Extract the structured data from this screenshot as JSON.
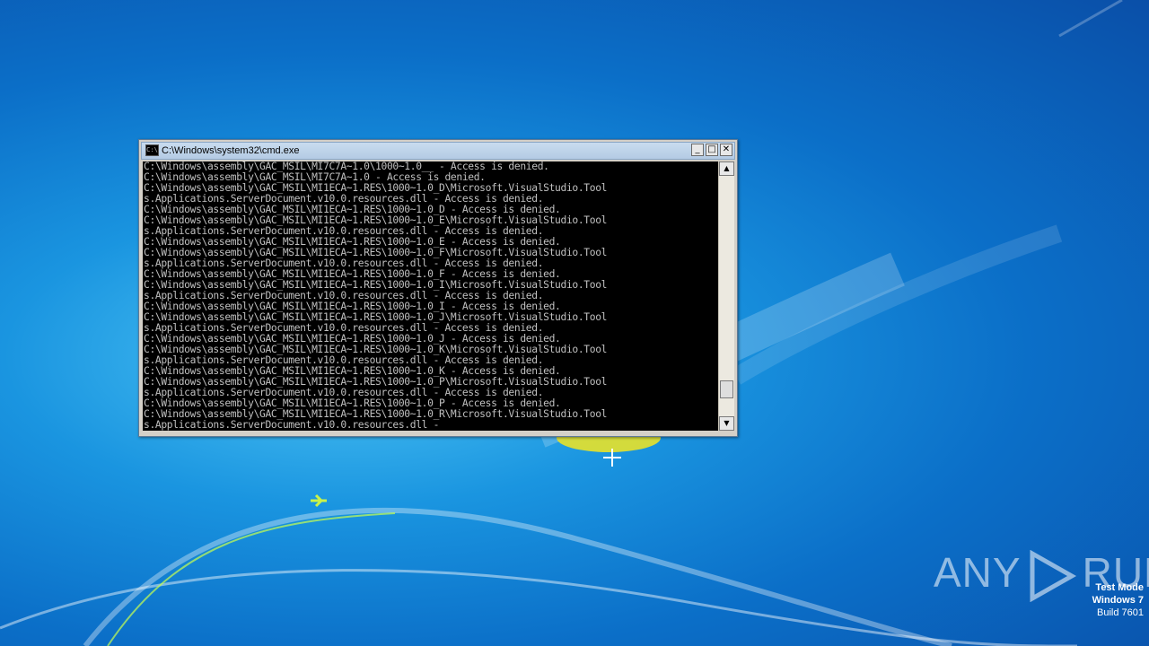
{
  "window": {
    "title": "C:\\Windows\\system32\\cmd.exe",
    "icon_label": "C:\\",
    "minimize_label": "_",
    "maximize_label": "□",
    "close_label": "✕"
  },
  "console": {
    "lines": [
      "C:\\Windows\\assembly\\GAC_MSIL\\MI7C7A~1.0\\1000~1.0__ - Access is denied.",
      "C:\\Windows\\assembly\\GAC_MSIL\\MI7C7A~1.0 - Access is denied.",
      "C:\\Windows\\assembly\\GAC_MSIL\\MI1ECA~1.RES\\1000~1.0_D\\Microsoft.VisualStudio.Tool",
      "s.Applications.ServerDocument.v10.0.resources.dll - Access is denied.",
      "C:\\Windows\\assembly\\GAC_MSIL\\MI1ECA~1.RES\\1000~1.0_D - Access is denied.",
      "C:\\Windows\\assembly\\GAC_MSIL\\MI1ECA~1.RES\\1000~1.0_E\\Microsoft.VisualStudio.Tool",
      "s.Applications.ServerDocument.v10.0.resources.dll - Access is denied.",
      "C:\\Windows\\assembly\\GAC_MSIL\\MI1ECA~1.RES\\1000~1.0_E - Access is denied.",
      "C:\\Windows\\assembly\\GAC_MSIL\\MI1ECA~1.RES\\1000~1.0_F\\Microsoft.VisualStudio.Tool",
      "s.Applications.ServerDocument.v10.0.resources.dll - Access is denied.",
      "C:\\Windows\\assembly\\GAC_MSIL\\MI1ECA~1.RES\\1000~1.0_F - Access is denied.",
      "C:\\Windows\\assembly\\GAC_MSIL\\MI1ECA~1.RES\\1000~1.0_I\\Microsoft.VisualStudio.Tool",
      "s.Applications.ServerDocument.v10.0.resources.dll - Access is denied.",
      "C:\\Windows\\assembly\\GAC_MSIL\\MI1ECA~1.RES\\1000~1.0_I - Access is denied.",
      "C:\\Windows\\assembly\\GAC_MSIL\\MI1ECA~1.RES\\1000~1.0_J\\Microsoft.VisualStudio.Tool",
      "s.Applications.ServerDocument.v10.0.resources.dll - Access is denied.",
      "C:\\Windows\\assembly\\GAC_MSIL\\MI1ECA~1.RES\\1000~1.0_J - Access is denied.",
      "C:\\Windows\\assembly\\GAC_MSIL\\MI1ECA~1.RES\\1000~1.0_K\\Microsoft.VisualStudio.Tool",
      "s.Applications.ServerDocument.v10.0.resources.dll - Access is denied.",
      "C:\\Windows\\assembly\\GAC_MSIL\\MI1ECA~1.RES\\1000~1.0_K - Access is denied.",
      "C:\\Windows\\assembly\\GAC_MSIL\\MI1ECA~1.RES\\1000~1.0_P\\Microsoft.VisualStudio.Tool",
      "s.Applications.ServerDocument.v10.0.resources.dll - Access is denied.",
      "C:\\Windows\\assembly\\GAC_MSIL\\MI1ECA~1.RES\\1000~1.0_P - Access is denied.",
      "C:\\Windows\\assembly\\GAC_MSIL\\MI1ECA~1.RES\\1000~1.0_R\\Microsoft.VisualStudio.Tool",
      "s.Applications.ServerDocument.v10.0.resources.dll -"
    ],
    "text_color": "#c0c0c0",
    "background_color": "#000000"
  },
  "scrollbar": {
    "up_label": "▲",
    "down_label": "▼",
    "scroll_position": 0.92
  },
  "watermark": {
    "text_left": "ANY",
    "text_right": "RUN"
  },
  "system_overlay": {
    "line1": "Test Mode",
    "line2": "Windows 7",
    "line3": "Build 7601"
  },
  "colors": {
    "desktop_blue": "#0b6fc8",
    "light_blue": "#4fc6f5"
  }
}
